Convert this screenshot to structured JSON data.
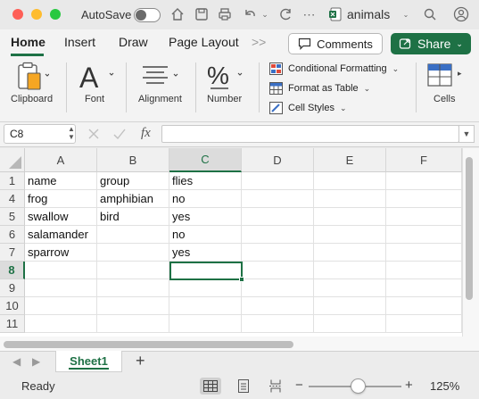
{
  "titlebar": {
    "autosave_label": "AutoSave",
    "document_title": "animals",
    "colors": {
      "close": "#fe5f57",
      "minimize": "#febc2e",
      "maximize": "#28c840"
    }
  },
  "ribbon_tabs": [
    "Home",
    "Insert",
    "Draw",
    "Page Layout"
  ],
  "overflow_tabs_glyph": ">>",
  "comments_label": "Comments",
  "share_label": "Share",
  "ribbon": {
    "clipboard": "Clipboard",
    "font": "Font",
    "alignment": "Alignment",
    "number": "Number",
    "conditional_formatting": "Conditional Formatting",
    "format_as_table": "Format as Table",
    "cell_styles": "Cell Styles",
    "cells": "Cells"
  },
  "formula_bar": {
    "name_box": "C8",
    "fx_label": "fx",
    "formula": ""
  },
  "columns": [
    "A",
    "B",
    "C",
    "D",
    "E",
    "F"
  ],
  "rows": [
    {
      "num": "1",
      "cells": [
        "name",
        "group",
        "flies",
        "",
        "",
        ""
      ]
    },
    {
      "num": "4",
      "cells": [
        "frog",
        "amphibian",
        "no",
        "",
        "",
        ""
      ]
    },
    {
      "num": "5",
      "cells": [
        "swallow",
        "bird",
        "yes",
        "",
        "",
        ""
      ]
    },
    {
      "num": "6",
      "cells": [
        "salamander",
        "",
        "no",
        "",
        "",
        ""
      ]
    },
    {
      "num": "7",
      "cells": [
        "sparrow",
        "",
        "yes",
        "",
        "",
        ""
      ]
    },
    {
      "num": "8",
      "cells": [
        "",
        "",
        "",
        "",
        "",
        ""
      ]
    },
    {
      "num": "9",
      "cells": [
        "",
        "",
        "",
        "",
        "",
        ""
      ]
    },
    {
      "num": "10",
      "cells": [
        "",
        "",
        "",
        "",
        "",
        ""
      ]
    },
    {
      "num": "11",
      "cells": [
        "",
        "",
        "",
        "",
        "",
        ""
      ]
    }
  ],
  "selected_cell": "C8",
  "sheets": [
    "Sheet1"
  ],
  "add_sheet_glyph": "+",
  "status": {
    "text": "Ready",
    "zoom_level": "125%",
    "zoom_minus": "−",
    "zoom_plus": "+"
  },
  "accent_color": "#1e7145"
}
